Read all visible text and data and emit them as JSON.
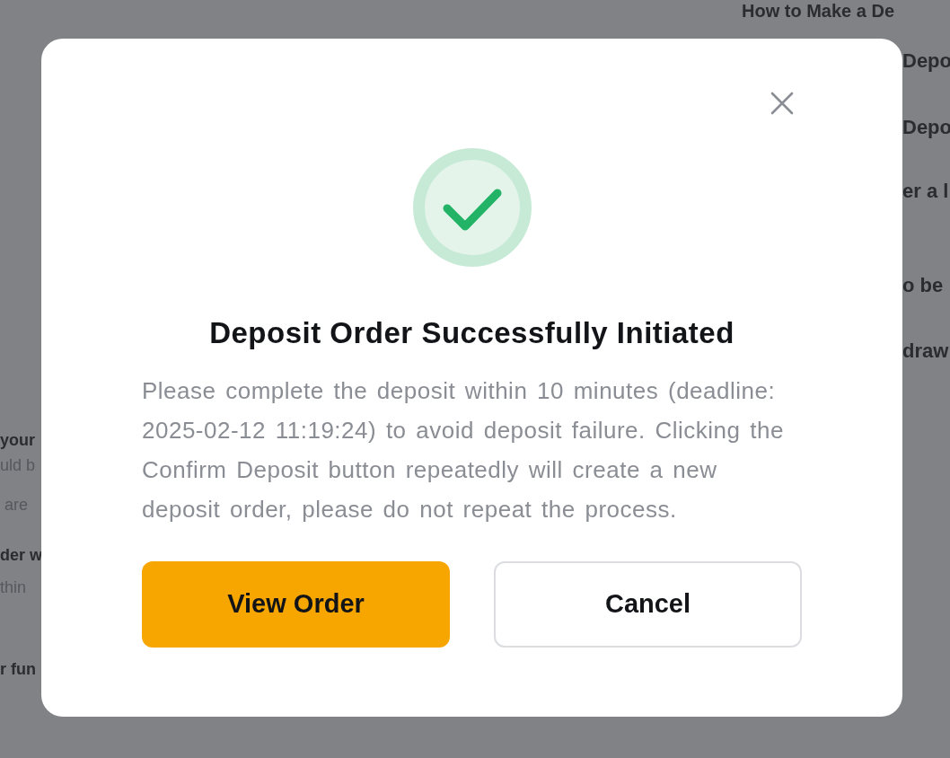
{
  "background": {
    "top_fragment": "How to Make a De",
    "left_fragments": [
      {
        "text": "your",
        "kind": "bold"
      },
      {
        "text": "uld b",
        "kind": "light"
      },
      {
        "text": "are",
        "kind": "light"
      },
      {
        "text": "der w",
        "kind": "bold"
      },
      {
        "text": "thin",
        "kind": "light"
      },
      {
        "text": "r fun",
        "kind": "bold"
      }
    ],
    "right_fragments": [
      {
        "text": "Depo",
        "kind": "bold"
      },
      {
        "text": "Depo",
        "kind": "bold"
      },
      {
        "text": "er a l",
        "kind": "bold"
      },
      {
        "text": "o be",
        "kind": "bold"
      },
      {
        "text": "draw",
        "kind": "bold"
      }
    ]
  },
  "modal": {
    "title": "Deposit Order Successfully Initiated",
    "message": "Please complete the deposit within 10 minutes (deadline: 2025-02-12 11:19:24) to avoid deposit failure. Clicking the Confirm Deposit button repeatedly will create a new deposit order, please do not repeat the process.",
    "buttons": [
      {
        "label": "View Order",
        "kind": "primary"
      },
      {
        "label": "Cancel",
        "kind": "secondary"
      }
    ]
  }
}
